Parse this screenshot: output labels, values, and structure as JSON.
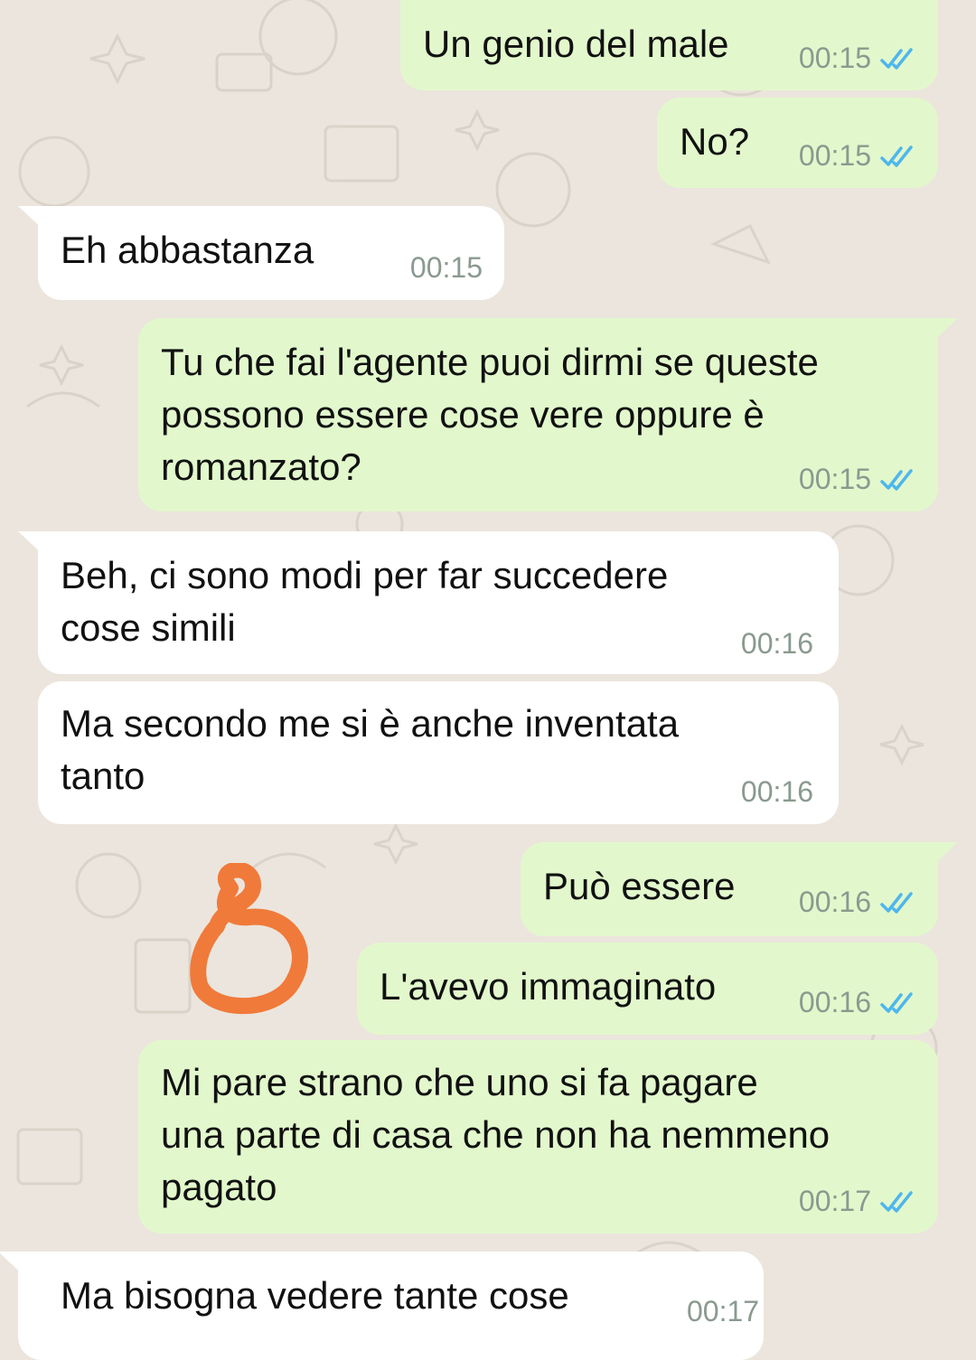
{
  "chat": {
    "messages": [
      {
        "direction": "outgoing",
        "text": "Un genio del male",
        "time": "00:15",
        "status": "read-double-tick"
      },
      {
        "direction": "outgoing",
        "text": "No?",
        "time": "00:15",
        "status": "read-double-tick"
      },
      {
        "direction": "incoming",
        "text": "Eh abbastanza",
        "time": "00:15"
      },
      {
        "direction": "outgoing",
        "text": "Tu che fai l'agente puoi dirmi se queste\npossono essere cose vere oppure è\nromanzato?",
        "time": "00:15",
        "status": "read-double-tick"
      },
      {
        "direction": "incoming",
        "text": "Beh, ci sono modi per far succedere\ncose simili",
        "time": "00:16"
      },
      {
        "direction": "incoming",
        "text": "Ma secondo me si è anche inventata\ntanto",
        "time": "00:16"
      },
      {
        "direction": "outgoing",
        "text": "Può essere",
        "time": "00:16",
        "status": "read-double-tick"
      },
      {
        "direction": "outgoing",
        "text": "L'avevo immaginato",
        "time": "00:16",
        "status": "read-double-tick"
      },
      {
        "direction": "outgoing",
        "text": "Mi pare strano che uno si fa pagare\nuna parte di casa che non ha nemmeno\npagato",
        "time": "00:17",
        "status": "read-double-tick"
      },
      {
        "direction": "incoming",
        "text": "Ma bisogna vedere tante cose",
        "time": "00:17"
      }
    ]
  },
  "annotation": {
    "glyph": "8 (orange handwritten mark)",
    "color": "#f07a3a"
  },
  "colors": {
    "outgoing_bubble": "#e2f8cc",
    "incoming_bubble": "#ffffff",
    "read_tick": "#4fb6ec",
    "timestamp": "#8a9a8f",
    "wallpaper": "#ece5dd"
  },
  "icons": [
    "double-check-icon"
  ]
}
